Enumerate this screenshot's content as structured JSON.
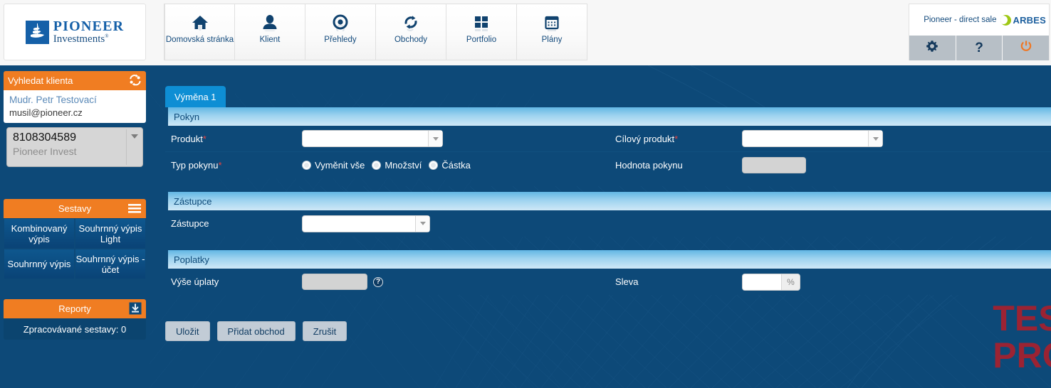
{
  "header": {
    "logo": {
      "line1": "PIONEER",
      "line2": "Investments",
      "trademark": "®",
      "icon": "ship-logo-icon"
    },
    "nav": [
      {
        "label": "Domovská stránka",
        "icon": "home-icon"
      },
      {
        "label": "Klient",
        "icon": "person-icon"
      },
      {
        "label": "Přehledy",
        "icon": "eye-icon"
      },
      {
        "label": "Obchody",
        "icon": "refresh-icon"
      },
      {
        "label": "Portfolio",
        "icon": "grid-icon"
      },
      {
        "label": "Plány",
        "icon": "calendar-icon"
      }
    ],
    "account": {
      "name": "Pioneer - direct sale",
      "brand": "ARBES",
      "buttons": [
        {
          "name": "settings",
          "icon": "gear-icon"
        },
        {
          "name": "help",
          "icon": "question-icon",
          "glyph": "?"
        },
        {
          "name": "logout",
          "icon": "power-icon"
        }
      ]
    }
  },
  "sidebar": {
    "client_panel": {
      "title": "Vyhledat klienta",
      "icon": "switch-client-icon",
      "client_name": "Mudr. Petr Testovací",
      "client_email": "musil@pioneer.cz",
      "account_number": "8108304589",
      "account_subtitle": "Pioneer Invest"
    },
    "sestavy_panel": {
      "title": "Sestavy",
      "icon": "hamburger-icon",
      "buttons": [
        "Kombinovaný výpis",
        "Souhrnný výpis Light",
        "Souhrnný výpis",
        "Souhrnný výpis - účet"
      ]
    },
    "reporty_panel": {
      "title": "Reporty",
      "icon": "download-icon",
      "status": "Zpracovávané sestavy: 0"
    }
  },
  "main": {
    "tabs": [
      {
        "label": "Výměna 1",
        "active": true
      }
    ],
    "sections": [
      {
        "title": "Pokyn",
        "rows": [
          {
            "left_label": "Produkt",
            "left_required": "*",
            "left_field": "dropdown",
            "left_value": "",
            "right_label": "Cílový produkt",
            "right_required": "*",
            "right_field": "dropdown",
            "right_value": ""
          },
          {
            "left_label": "Typ pokynu",
            "left_required": "*",
            "left_field": "radios",
            "radios": [
              {
                "label": "Vyměnit vše",
                "selected": false
              },
              {
                "label": "Množství",
                "selected": false
              },
              {
                "label": "Částka",
                "selected": false
              }
            ],
            "right_label": "Hodnota pokynu",
            "right_required": "",
            "right_field": "disabled",
            "right_value": ""
          }
        ]
      },
      {
        "title": "Zástupce",
        "rows": [
          {
            "left_label": "Zástupce",
            "left_required": "",
            "left_field": "dropdown",
            "left_value": "",
            "right_label": "",
            "right_required": "",
            "right_field": "none",
            "right_value": ""
          }
        ]
      },
      {
        "title": "Poplatky",
        "rows": [
          {
            "left_label": "Výše úplaty",
            "left_required": "",
            "left_field": "disabled-help",
            "left_value": "",
            "help_glyph": "?",
            "right_label": "Sleva",
            "right_required": "",
            "right_field": "percent",
            "right_value": "",
            "percent_suffix": "%"
          }
        ]
      }
    ],
    "actions": [
      "Uložit",
      "Přidat obchod",
      "Zrušit"
    ],
    "watermark": {
      "line1": "TEST",
      "line2": "PROS"
    }
  },
  "colors": {
    "page_bg": "#0d4978",
    "accent_orange": "#f07d22",
    "tab_active": "#0e8ed4",
    "required_red": "#e8423f",
    "watermark_red": "#a8202e",
    "brand_blue": "#1560a8",
    "arbes_green": "#9fc814"
  }
}
